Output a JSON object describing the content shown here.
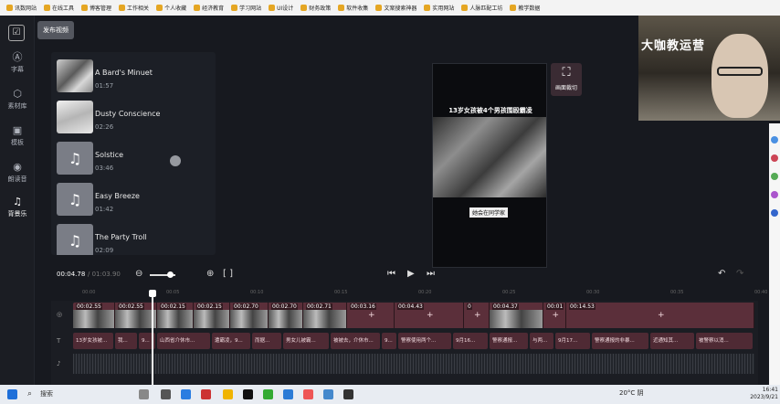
{
  "bookmarks": [
    "讯数网站",
    "在线工具",
    "博客管理",
    "工作相关",
    "个人收藏",
    "经济教育",
    "学习网站",
    "UI设计",
    "财务政策",
    "软件收集",
    "文案搜索神器",
    "实用网站",
    "人脉匹配工坊",
    "教学数据"
  ],
  "sidebar": {
    "items": [
      {
        "label": "字幕",
        "icon": "text-icon"
      },
      {
        "label": "素材库",
        "icon": "cube-icon"
      },
      {
        "label": "模板",
        "icon": "template-icon"
      },
      {
        "label": "朗读音",
        "icon": "voice-icon"
      },
      {
        "label": "背景乐",
        "icon": "music-icon"
      }
    ]
  },
  "header": {
    "publish_label": "发布视频"
  },
  "library": {
    "tracks": [
      {
        "name": "A Bard's Minuet",
        "duration": "01:57",
        "thumb": "photo"
      },
      {
        "name": "Dusty Conscience",
        "duration": "02:26",
        "thumb": "photo2"
      },
      {
        "name": "Solstice",
        "duration": "03:46",
        "thumb": "note"
      },
      {
        "name": "Easy Breeze",
        "duration": "01:42",
        "thumb": "note"
      },
      {
        "name": "The Party Troll",
        "duration": "02:09",
        "thumb": "note"
      }
    ]
  },
  "player": {
    "title": "13岁女孩被4个男孩围殴霸凌",
    "caption": "她会在同学家"
  },
  "crop": {
    "label": "画面裁切"
  },
  "webcam": {
    "overlay_text": "大咖教运营"
  },
  "controls": {
    "current_time": "00:04.78",
    "total_time": "/ 01:03.90",
    "zoom_level": 0.8
  },
  "ruler": [
    "00:00",
    "00:05",
    "00:10",
    "00:15",
    "00:20",
    "00:25",
    "00:30",
    "00:35",
    "00:40"
  ],
  "clips": [
    {
      "time": "00:02.55"
    },
    {
      "time": "00:02.55"
    },
    {
      "time": "00:02.15"
    },
    {
      "time": "00:02.15"
    },
    {
      "time": "00:02.70"
    },
    {
      "time": "00:02.70"
    },
    {
      "time": "00:02.71"
    },
    {
      "time": "00:03.16"
    },
    {
      "time": "00:04.43"
    },
    {
      "time": "0"
    },
    {
      "time": "00:04.37"
    },
    {
      "time": "00:01"
    },
    {
      "time": "00:14.53"
    }
  ],
  "subtitles": [
    "13岁女孩被...",
    "我...",
    "9...",
    "山西省介休市...",
    "遭霸凌，9...",
    "而据...",
    "男女儿被霸...",
    "被被去，介休市...",
    "9...",
    "警察使用两个...",
    "9月16...",
    "警察通报...",
    "与两...",
    "9月17...",
    "警察通报的非暴...",
    "近通知其...",
    "被警察以消..."
  ],
  "taskbar": {
    "search_placeholder": "搜索",
    "weather": "20°C 阴",
    "time": "16:41",
    "date": "2023/9/21"
  }
}
